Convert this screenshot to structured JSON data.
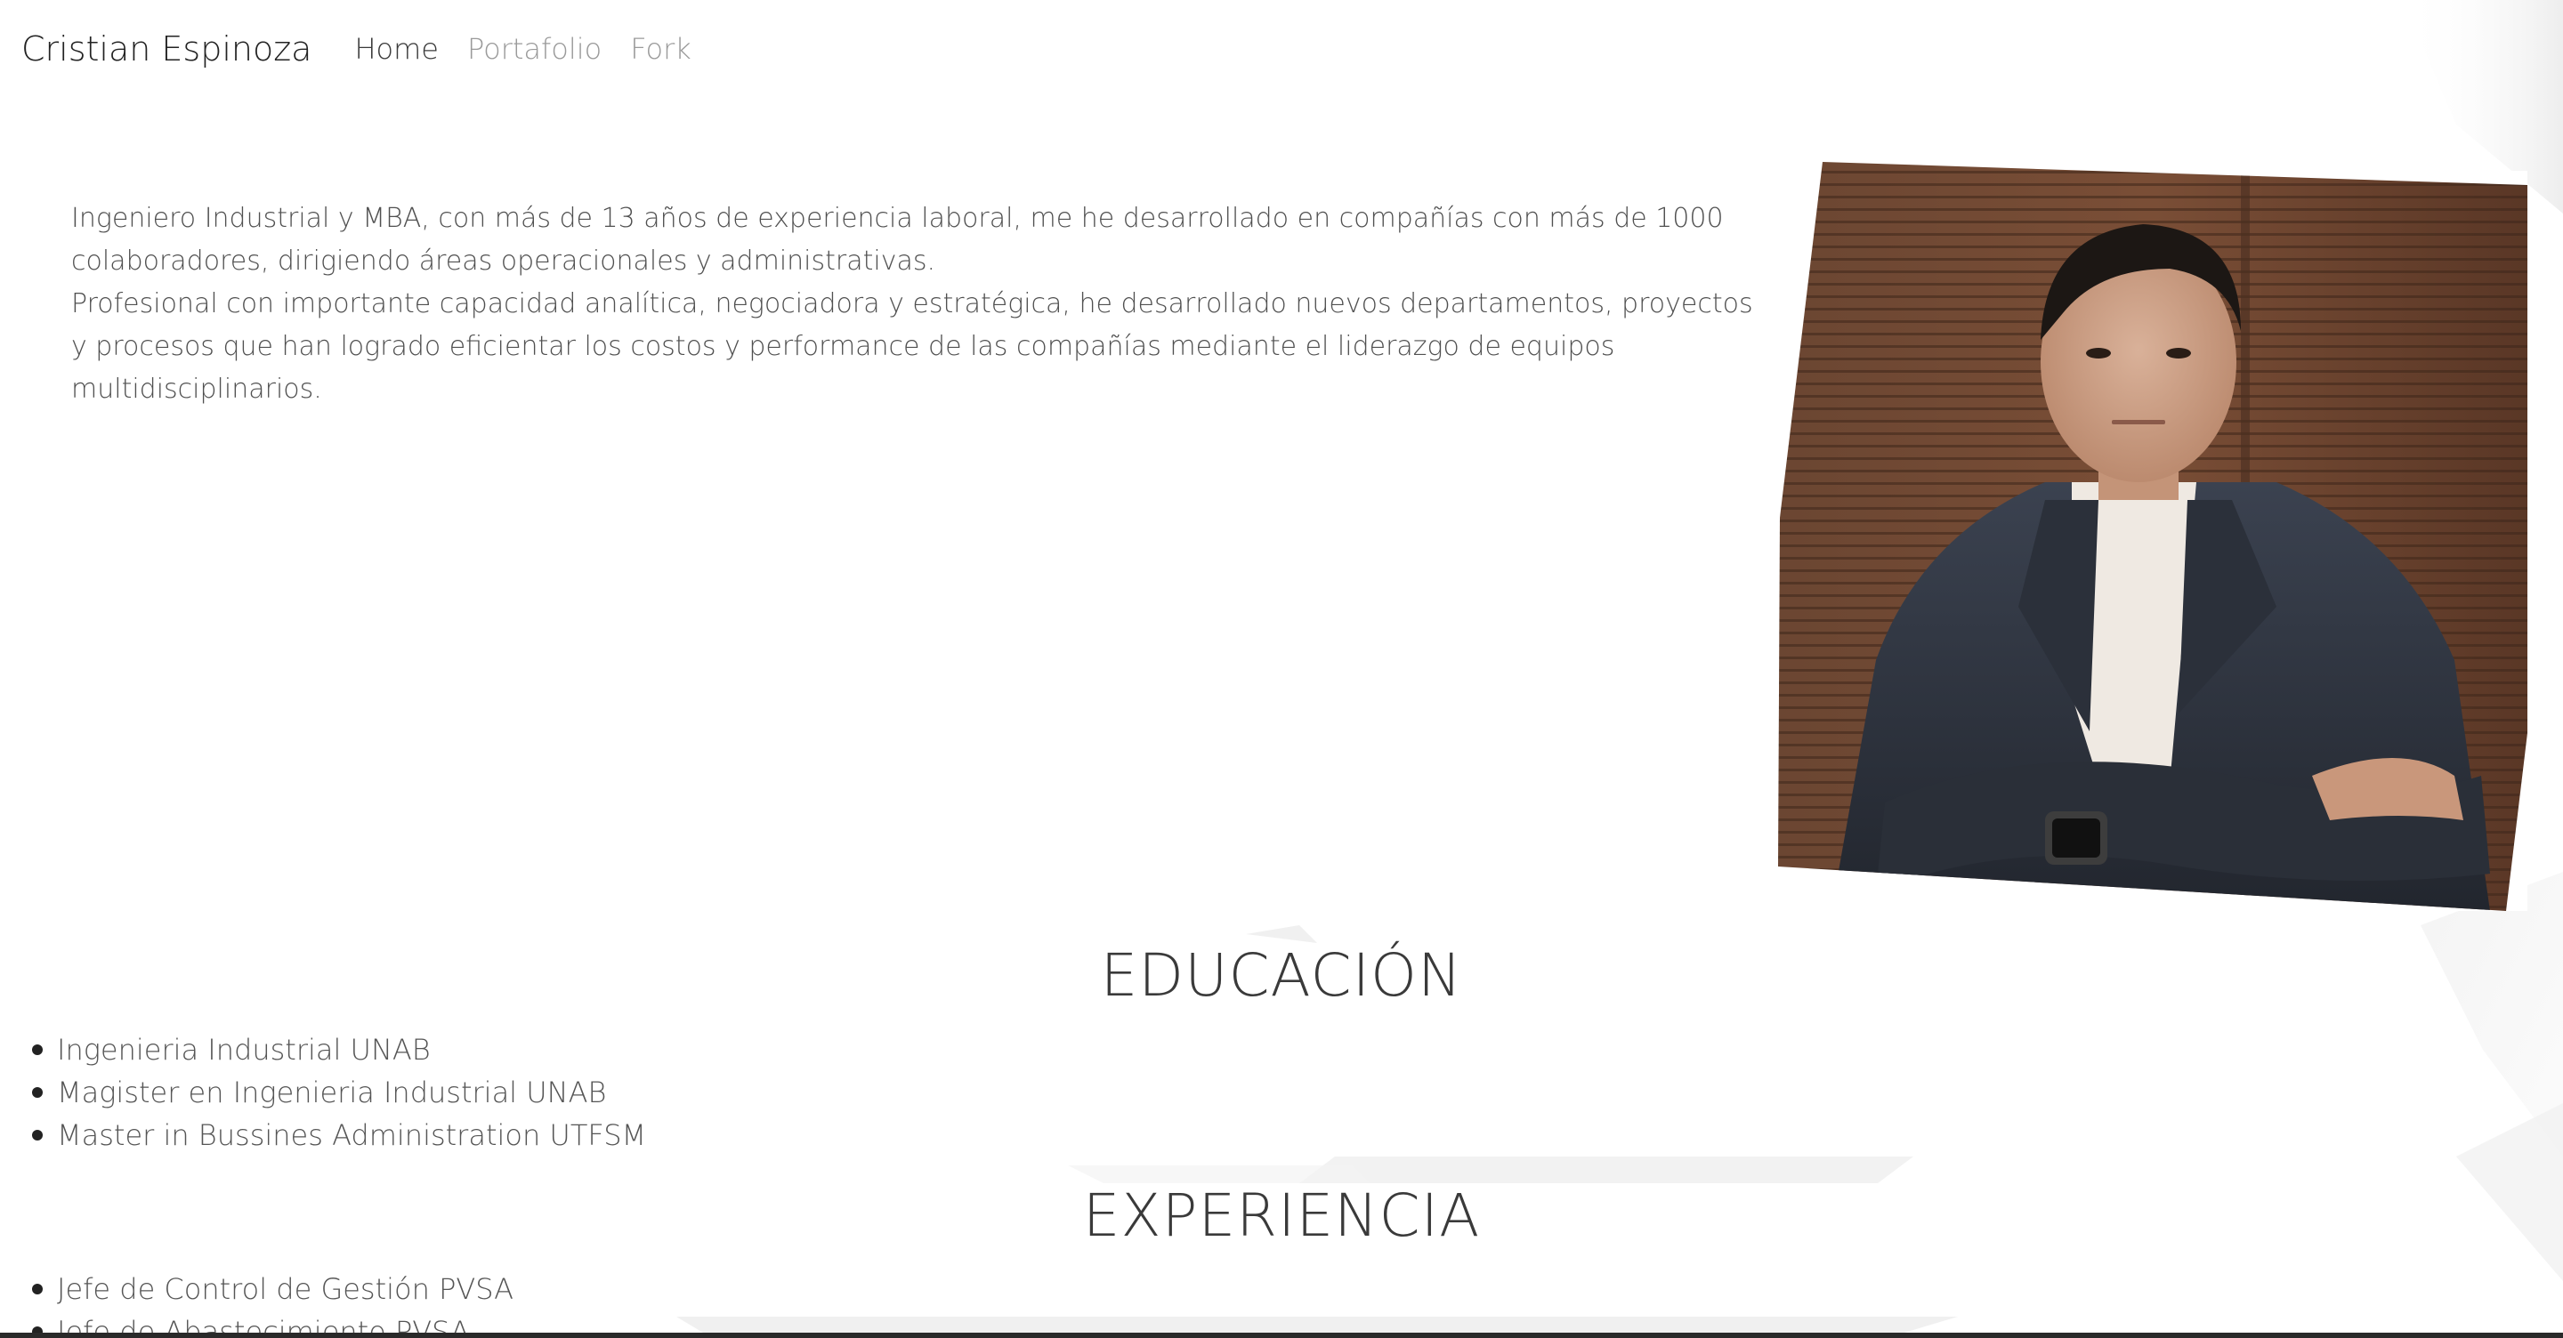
{
  "navbar": {
    "brand": "Cristian Espinoza",
    "links": [
      {
        "label": "Home",
        "active": true
      },
      {
        "label": "Portafolio",
        "active": false
      },
      {
        "label": "Fork",
        "active": false
      }
    ]
  },
  "intro": {
    "paragraph_1": "Ingeniero Industrial y MBA, con más de 13 años de experiencia laboral, me he desarrollado en compañías con más de 1000 colaboradores, dirigiendo áreas operacionales y administrativas.",
    "paragraph_2": "Profesional con importante capacidad analítica, negociadora y estratégica, he desarrollado nuevos departamentos, proyectos y procesos que han logrado eficientar los costos y performance de las compañías mediante el liderazgo de equipos multidisciplinarios."
  },
  "portrait": {
    "description_icon": "profile-photo"
  },
  "education": {
    "title": "EDUCACIÓN",
    "items": [
      "Ingenieria Industrial UNAB",
      "Magister en Ingenieria Industrial UNAB",
      "Master in Bussines Administration UTFSM"
    ]
  },
  "experience": {
    "title": "EXPERIENCIA",
    "items": [
      "Jefe de Control de Gestión PVSA",
      "Jefe de Abastecimiento PVSA"
    ]
  },
  "colors": {
    "text": "#505050",
    "nav_inactive": "#9a9a9a",
    "nav_active": "#3a3a3a",
    "background": "#ffffff"
  }
}
